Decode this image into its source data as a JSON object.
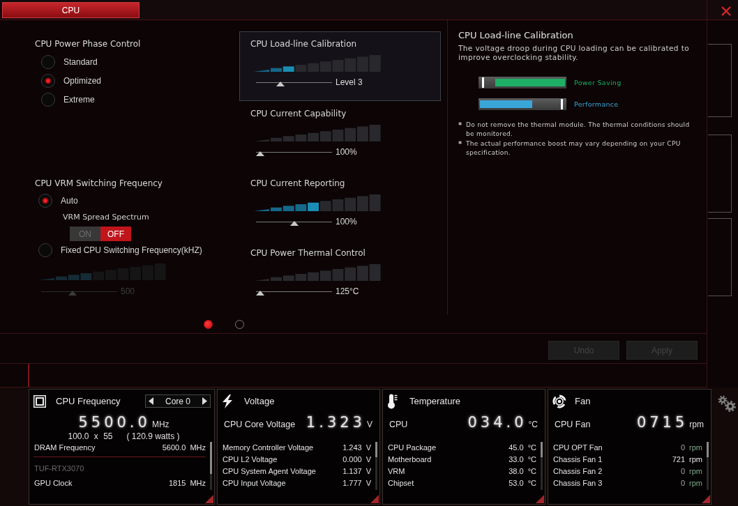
{
  "tabs": [
    {
      "label": "CPU",
      "selected": true
    }
  ],
  "power_phase": {
    "title": "CPU Power Phase Control",
    "options": [
      {
        "label": "Standard",
        "selected": false
      },
      {
        "label": "Optimized",
        "selected": true
      },
      {
        "label": "Extreme",
        "selected": false
      }
    ]
  },
  "vrm_frequency": {
    "title": "CPU VRM Switching Frequency",
    "options": [
      {
        "label": "Auto",
        "selected": true,
        "spread_spectrum": {
          "label": "VRM Spread Spectrum",
          "on_label": "ON",
          "off_label": "OFF",
          "on": false
        }
      },
      {
        "label": "Fixed CPU Switching Frequency(kHZ)",
        "selected": false,
        "slider": {
          "level": 0.4,
          "value": "500",
          "disabled": true
        }
      }
    ]
  },
  "sliders": [
    {
      "title": "CPU Load-line Calibration",
      "selected": true,
      "level": 0.3,
      "value": "Level 3"
    },
    {
      "title": "CPU Current Capability",
      "selected": false,
      "level": 0,
      "value": "100%"
    },
    {
      "title": "CPU Current Reporting",
      "selected": false,
      "level": 0.5,
      "value": "100%"
    },
    {
      "title": "CPU Power Thermal Control",
      "selected": false,
      "level": 0,
      "value": "125°C"
    }
  ],
  "info": {
    "title": "CPU Load-line Calibration",
    "description": "The voltage droop during CPU loading can be calibrated to improve overclocking stability.",
    "legend": [
      {
        "kind": "saving",
        "label": "Power Saving",
        "color": "#1fae66"
      },
      {
        "kind": "performance",
        "label": "Performance",
        "color": "#3aa6d8"
      }
    ],
    "notes": [
      {
        "mark": "*",
        "text": "Do not remove the thermal module. The thermal conditions should be monitored."
      },
      {
        "mark": "*",
        "text": "The actual performance boost may vary depending on your CPU specification."
      }
    ]
  },
  "pages": [
    {
      "selected": true
    },
    {
      "selected": false
    }
  ],
  "actions": [
    {
      "label": "Undo",
      "disabled": true
    },
    {
      "label": "Apply",
      "disabled": true
    }
  ],
  "monitor": [
    {
      "kind": "frequency",
      "title": "CPU Frequency",
      "selector": "Core 0",
      "reading": {
        "value": "5500.0",
        "unit": "MHz"
      },
      "ratio": "100.0 x 55",
      "power": "( 120.9 watts )",
      "rows": [
        {
          "kind": "item",
          "label": "DRAM Frequency",
          "value": "5600.0",
          "unit": "MHz"
        },
        {
          "kind": "heading",
          "label": "TUF-RTX3070"
        },
        {
          "kind": "item",
          "label": "GPU Clock",
          "value": "1815",
          "unit": "MHz"
        }
      ]
    },
    {
      "kind": "voltage",
      "title": "Voltage",
      "reading": {
        "label": "CPU Core Voltage",
        "value": "1.323",
        "unit": "V"
      },
      "rows": [
        {
          "kind": "item",
          "label": "Memory Controller Voltage",
          "value": "1.243",
          "unit": "V"
        },
        {
          "kind": "item",
          "label": "CPU L2 Voltage",
          "value": "0.000",
          "unit": "V"
        },
        {
          "kind": "item",
          "label": "CPU System Agent Voltage",
          "value": "1.137",
          "unit": "V"
        },
        {
          "kind": "item",
          "label": "CPU Input Voltage",
          "value": "1.777",
          "unit": "V"
        }
      ]
    },
    {
      "kind": "temperature",
      "title": "Temperature",
      "reading": {
        "label": "CPU",
        "value": "034.0",
        "unit": "°C"
      },
      "rows": [
        {
          "kind": "item",
          "label": "CPU Package",
          "value": "45.0",
          "unit": "°C"
        },
        {
          "kind": "item",
          "label": "Motherboard",
          "value": "33.0",
          "unit": "°C"
        },
        {
          "kind": "item",
          "label": "VRM",
          "value": "38.0",
          "unit": "°C"
        },
        {
          "kind": "item",
          "label": "Chipset",
          "value": "53.0",
          "unit": "°C"
        }
      ]
    },
    {
      "kind": "fan",
      "title": "Fan",
      "reading": {
        "label": "CPU Fan",
        "value": "0715",
        "unit": "rpm"
      },
      "rows": [
        {
          "kind": "item",
          "label": "CPU OPT Fan",
          "value": "0",
          "unit": "rpm",
          "idle": true
        },
        {
          "kind": "item",
          "label": "Chassis Fan 1",
          "value": "721",
          "unit": "rpm",
          "idle": false
        },
        {
          "kind": "item",
          "label": "Chassis Fan 2",
          "value": "0",
          "unit": "rpm",
          "idle": true
        },
        {
          "kind": "item",
          "label": "Chassis Fan 3",
          "value": "0",
          "unit": "rpm",
          "idle": true
        }
      ]
    }
  ]
}
